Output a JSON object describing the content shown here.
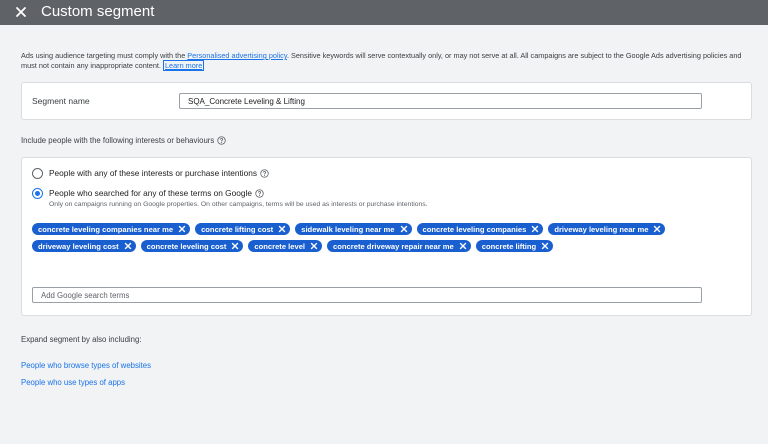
{
  "header": {
    "title": "Custom segment"
  },
  "notice": {
    "text_before": "Ads using audience targeting must comply with the ",
    "policy_link": "Personalised advertising policy",
    "text_after": ". Sensitive keywords will serve contextually only, or may not serve at all. All campaigns are subject to the Google Ads advertising policies and must not contain any inappropriate content. ",
    "learn_more": "Learn more"
  },
  "segment": {
    "label": "Segment name",
    "value": "SQA_Concrete Leveling & Lifting"
  },
  "include": {
    "label": "Include people with the following interests or behaviours",
    "option1": "People with any of these interests or purchase intentions",
    "option2": "People who searched for any of these terms on Google",
    "option2_sub": "Only on campaigns running on Google properties. On other campaigns, terms will be used as interests or purchase intentions.",
    "selected": "option2",
    "chips": [
      "concrete leveling companies near me",
      "concrete lifting cost",
      "sidewalk leveling near me",
      "concrete leveling companies",
      "driveway leveling near me",
      "driveway leveling cost",
      "concrete leveling cost",
      "concrete level",
      "concrete driveway repair near me",
      "concrete lifting"
    ],
    "add_placeholder": "Add Google search terms"
  },
  "expand": {
    "label": "Expand segment by also including:",
    "link1": "People who browse types of websites",
    "link2": "People who use types of apps"
  },
  "colors": {
    "accent": "#1a73e8",
    "chip": "#1a5fd0",
    "header": "#5f6368",
    "background": "#f1f3f4"
  }
}
